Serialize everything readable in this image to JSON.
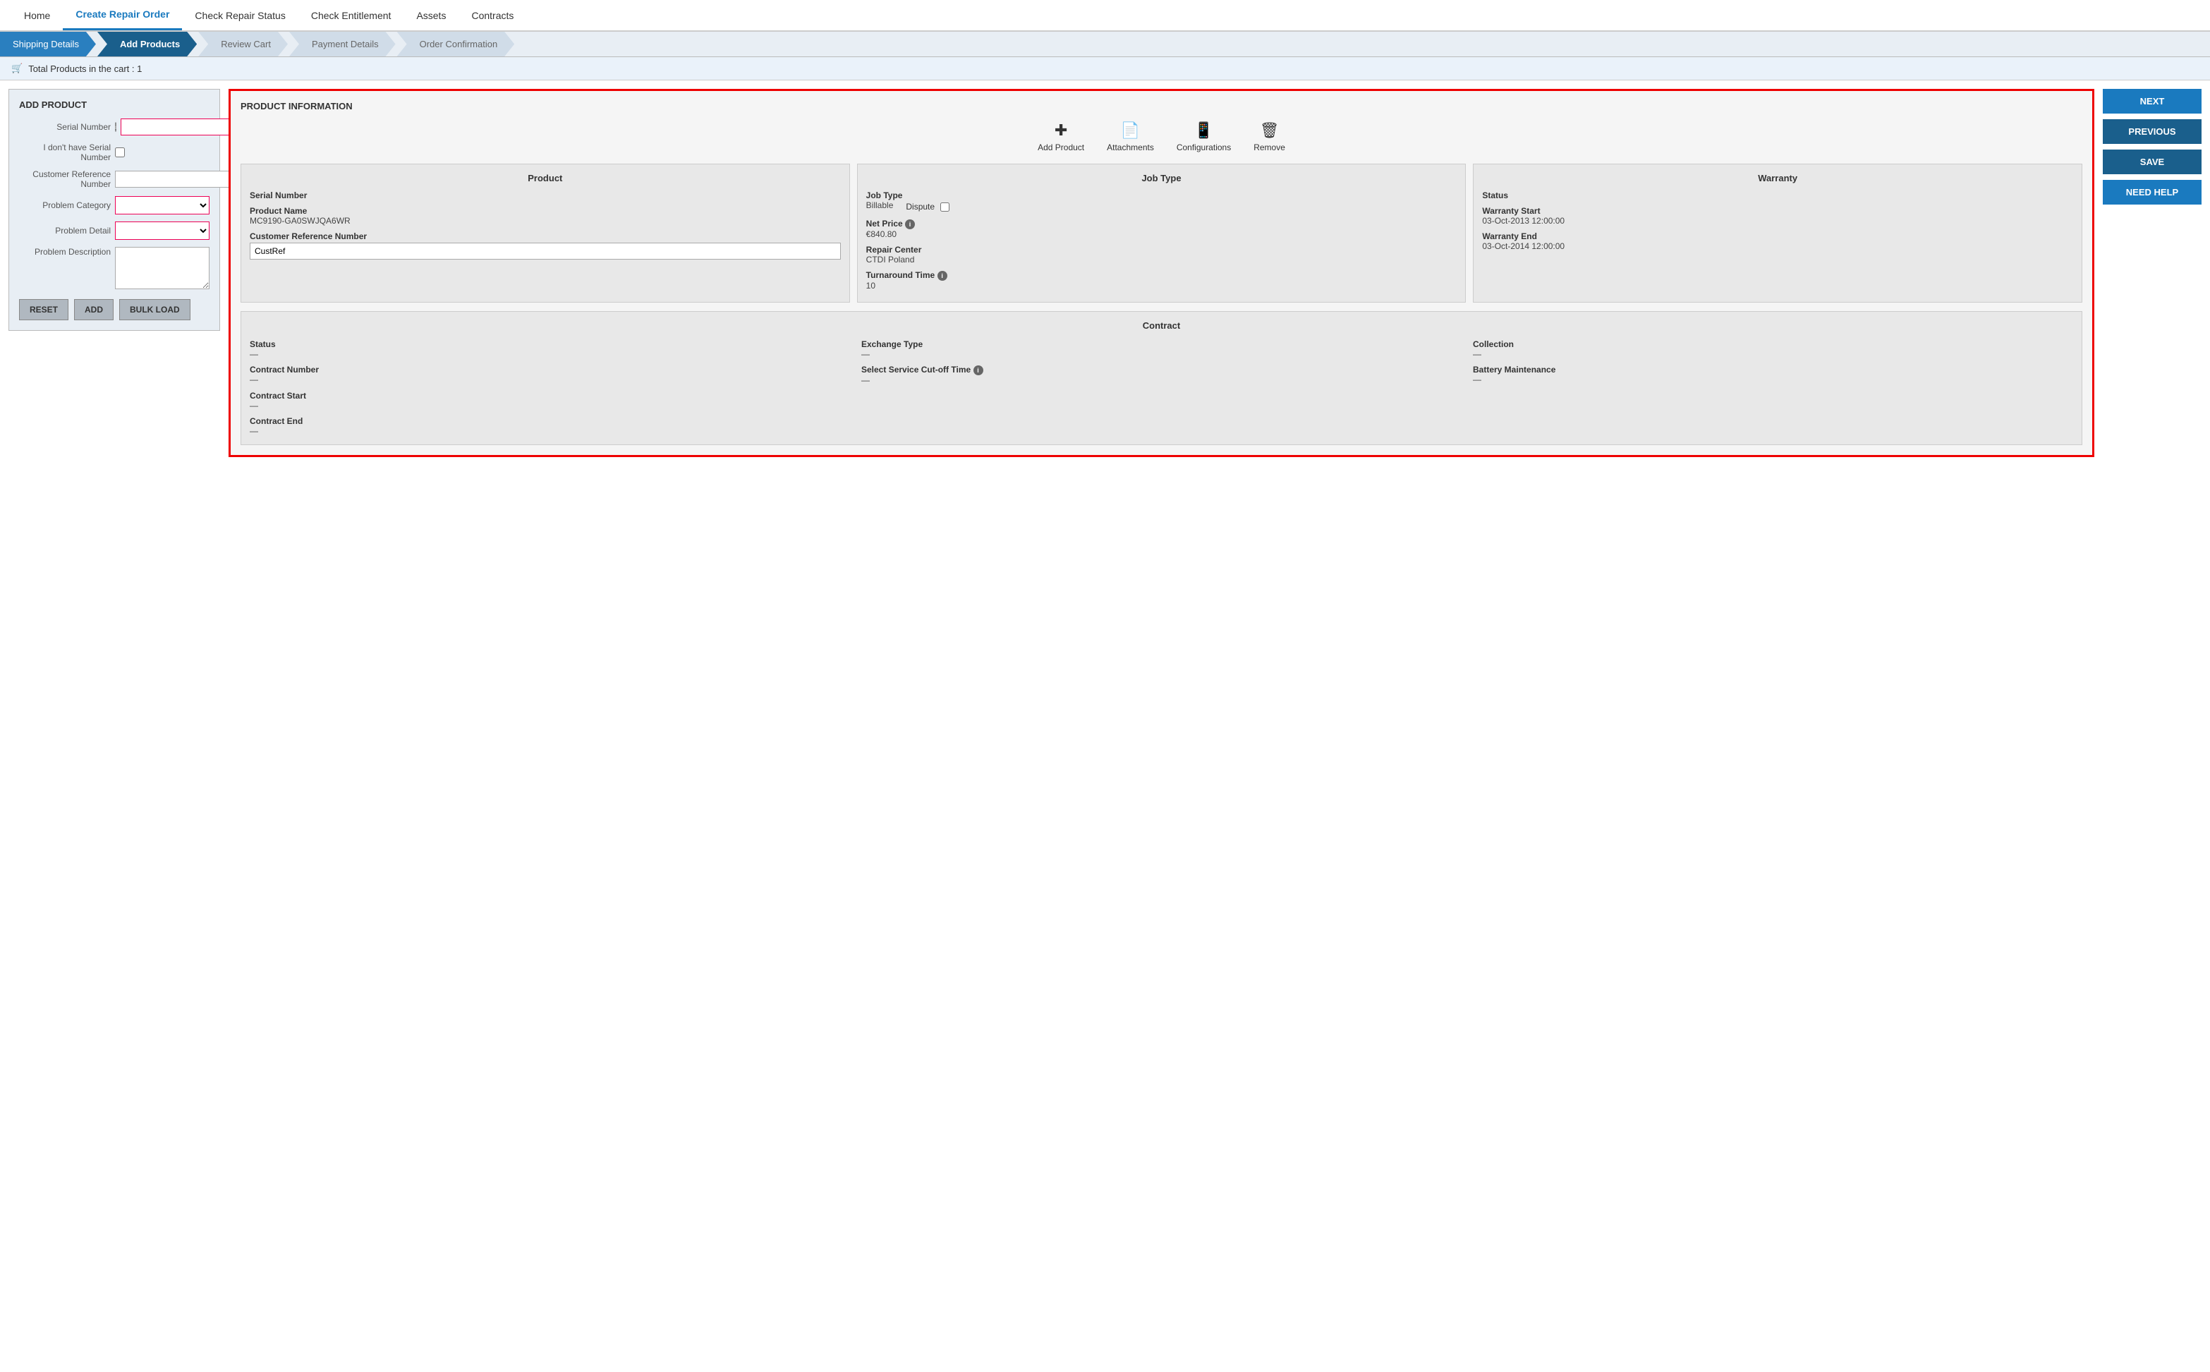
{
  "nav": {
    "items": [
      {
        "label": "Home",
        "active": false
      },
      {
        "label": "Create Repair Order",
        "active": true
      },
      {
        "label": "Check Repair Status",
        "active": false
      },
      {
        "label": "Check Entitlement",
        "active": false
      },
      {
        "label": "Assets",
        "active": false
      },
      {
        "label": "Contracts",
        "active": false
      }
    ]
  },
  "stepper": {
    "steps": [
      {
        "label": "Shipping Details",
        "state": "completed"
      },
      {
        "label": "Add Products",
        "state": "active"
      },
      {
        "label": "Review Cart",
        "state": "inactive"
      },
      {
        "label": "Payment Details",
        "state": "inactive"
      },
      {
        "label": "Order Confirmation",
        "state": "inactive"
      }
    ]
  },
  "cart": {
    "icon": "🛒",
    "label": "Total Products in the cart : 1"
  },
  "left_panel": {
    "title": "ADD PRODUCT",
    "fields": {
      "serial_number_label": "Serial Number",
      "serial_number_placeholder": "",
      "no_serial_label": "I don't have Serial Number",
      "customer_ref_label": "Customer Reference Number",
      "problem_category_label": "Problem Category",
      "problem_detail_label": "Problem Detail",
      "problem_description_label": "Problem Description"
    },
    "buttons": {
      "reset": "RESET",
      "add": "ADD",
      "bulk_load": "BULK LOAD"
    }
  },
  "product_info": {
    "title": "PRODUCT INFORMATION",
    "toolbar": [
      {
        "icon": "+",
        "label": "Add Product",
        "name": "add-product-tool"
      },
      {
        "icon": "📄",
        "label": "Attachments",
        "name": "attachments-tool"
      },
      {
        "icon": "📱",
        "label": "Configurations",
        "name": "configurations-tool"
      },
      {
        "icon": "🗑",
        "label": "Remove",
        "name": "remove-tool"
      }
    ],
    "product_card": {
      "title": "Product",
      "serial_number_label": "Serial Number",
      "serial_number_value": "",
      "product_name_label": "Product Name",
      "product_name_value": "MC9190-GA0SWJQA6WR",
      "customer_ref_label": "Customer Reference Number",
      "customer_ref_value": "CustRef"
    },
    "job_type_card": {
      "title": "Job Type",
      "job_type_label": "Job Type",
      "job_type_value": "Billable",
      "dispute_label": "Dispute",
      "net_price_label": "Net Price",
      "net_price_value": "€840.80",
      "repair_center_label": "Repair Center",
      "repair_center_value": "CTDI Poland",
      "turnaround_label": "Turnaround Time",
      "turnaround_value": "10"
    },
    "warranty_card": {
      "title": "Warranty",
      "status_label": "Status",
      "status_value": "",
      "warranty_start_label": "Warranty Start",
      "warranty_start_value": "03-Oct-2013 12:00:00",
      "warranty_end_label": "Warranty End",
      "warranty_end_value": "03-Oct-2014 12:00:00"
    },
    "contract_card": {
      "title": "Contract",
      "fields": [
        {
          "label": "Status",
          "value": "—",
          "col": 1
        },
        {
          "label": "Exchange Type",
          "value": "—",
          "col": 2
        },
        {
          "label": "Collection",
          "value": "—",
          "col": 3
        },
        {
          "label": "Contract Number",
          "value": "—",
          "col": 1
        },
        {
          "label": "Select Service Cut-off Time",
          "value": "—",
          "col": 2
        },
        {
          "label": "Battery Maintenance",
          "value": "—",
          "col": 3
        },
        {
          "label": "Contract Start",
          "value": "—",
          "col": 1
        },
        {
          "label": "",
          "value": "",
          "col": 2
        },
        {
          "label": "",
          "value": "",
          "col": 3
        },
        {
          "label": "Contract End",
          "value": "—",
          "col": 1
        }
      ]
    }
  },
  "right_panel": {
    "next": "NEXT",
    "previous": "PREVIOUS",
    "save": "SAVE",
    "need_help": "NEED HELP"
  }
}
